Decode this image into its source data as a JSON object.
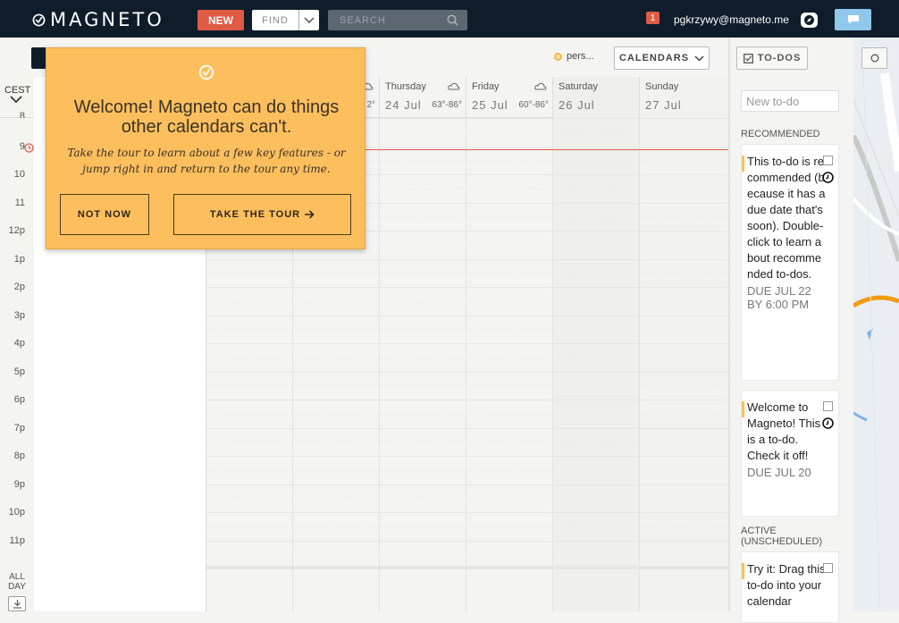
{
  "topbar": {
    "logo_text": "MAGNETO",
    "new_label": "NEW",
    "find_label": "FIND",
    "search_placeholder": "SEARCH",
    "notification_count": "1",
    "user_email": "pgkrzywy@magneto.me"
  },
  "calendar_header": {
    "persona_label": "pers...",
    "calendars_label": "CALENDARS",
    "timezone": "CEST"
  },
  "days": [
    {
      "name": "Thursday",
      "date": "24 Jul",
      "weather": "63°-86°"
    },
    {
      "name": "Friday",
      "date": "25 Jul",
      "weather": "60°-86°"
    },
    {
      "name": "Saturday",
      "date": "26 Jul",
      "weather": ""
    },
    {
      "name": "Sunday",
      "date": "27 Jul",
      "weather": ""
    }
  ],
  "partial_weather": "2°",
  "hours": [
    "8",
    "9",
    "10",
    "11",
    "12p",
    "1p",
    "2p",
    "3p",
    "4p",
    "5p",
    "6p",
    "7p",
    "8p",
    "9p",
    "10p",
    "11p"
  ],
  "allday_label": "ALL DAY",
  "popover": {
    "title": "Welcome! Magneto can do things other calendars can't.",
    "subtitle": "Take the tour to learn about a few key features - or jump right in and return to the tour any time.",
    "not_now_label": "NOT NOW",
    "tour_label": "TAKE THE TOUR"
  },
  "todos": {
    "button_label": "TO-DOS",
    "new_placeholder": "New to-do",
    "recommended_label": "RECOMMENDED",
    "active_label": "ACTIVE (UNSCHEDULED)",
    "items": [
      {
        "text": "This to-do is recommended (because it has a due date that's soon). Double-click to learn about recommended to-dos.",
        "due": "DUE JUL 22 BY 6:00 PM"
      },
      {
        "text": "Welcome to Magneto! This is a to-do. Check it off!",
        "due": "DUE JUL 20"
      },
      {
        "text": "Try it: Drag this to-do into your calendar",
        "due": ""
      }
    ]
  },
  "colors": {
    "topbar_bg": "#0f1d2b",
    "new_button": "#e05a44",
    "popover_bg": "#fdbf5e",
    "todo_accent": "#fdbf5e"
  }
}
